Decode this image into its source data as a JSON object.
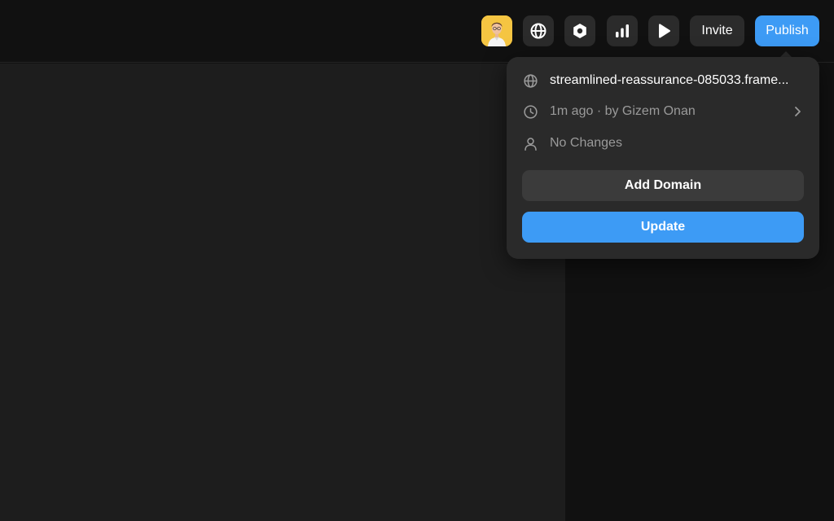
{
  "toolbar": {
    "avatar_name": "user-avatar",
    "invite_label": "Invite",
    "publish_label": "Publish"
  },
  "publish_popover": {
    "url": "streamlined-reassurance-085033.frame...",
    "last_published": "1m ago · by Gizem Onan",
    "changes_status": "No Changes",
    "add_domain_label": "Add Domain",
    "update_label": "Update"
  },
  "icons": {
    "globe": "globe-icon",
    "hexagon": "hexagon-icon",
    "analytics": "bar-chart-icon",
    "play": "play-icon",
    "clock": "clock-icon",
    "person": "user-icon",
    "chevron": "chevron-right-icon"
  },
  "colors": {
    "accent": "#3d9bf5",
    "toolbar_bg": "#111111",
    "canvas_bg": "#1d1d1d",
    "popover_bg": "#2a2a2a",
    "button_bg": "#2b2b2b",
    "avatar_bg": "#f5c542"
  }
}
